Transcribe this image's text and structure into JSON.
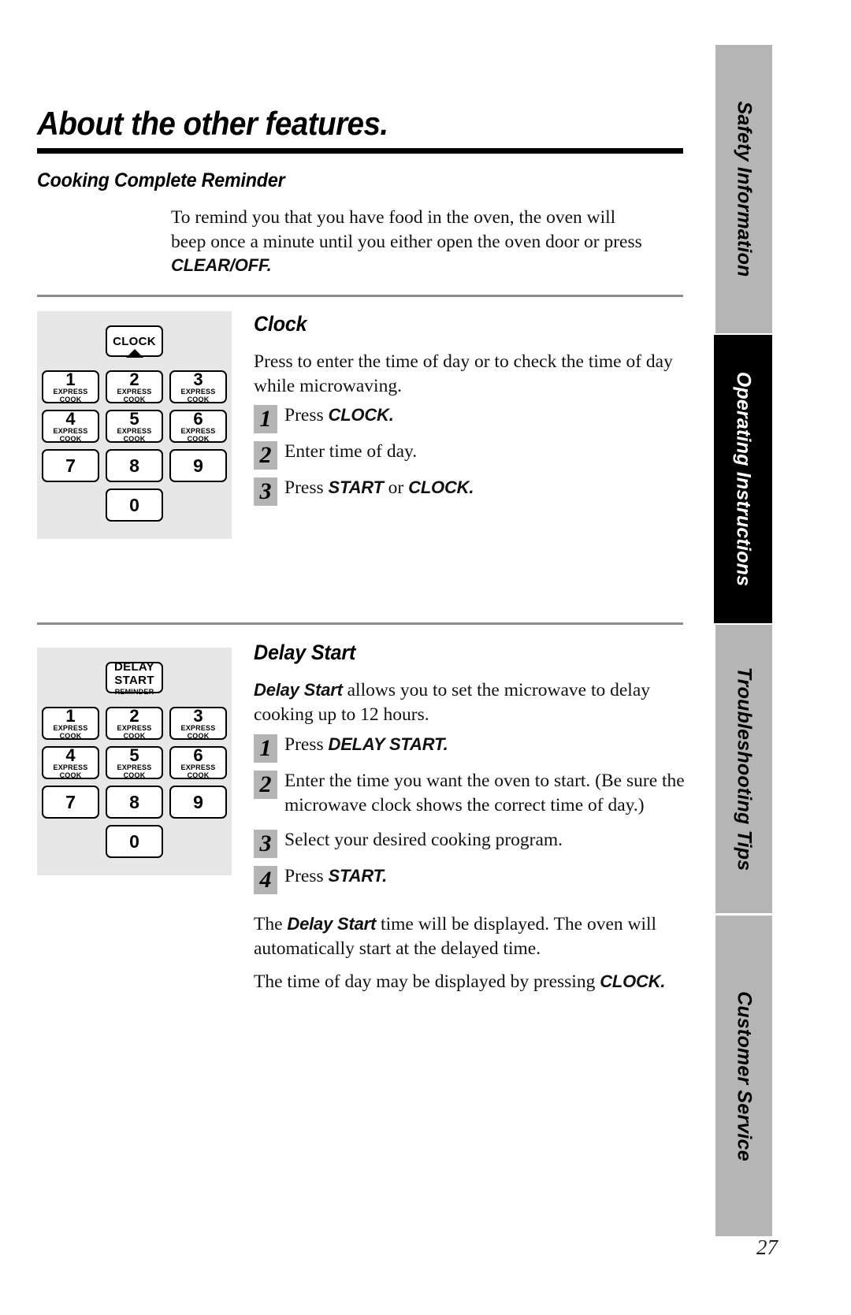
{
  "page": {
    "title": "About the other features.",
    "number": "27"
  },
  "sidebar": {
    "tabs": [
      {
        "label": "Safety Information",
        "active": false
      },
      {
        "label": "Operating Instructions",
        "active": true
      },
      {
        "label": "Troubleshooting Tips",
        "active": false
      },
      {
        "label": "Customer Service",
        "active": false
      }
    ]
  },
  "sections": {
    "reminder": {
      "heading": "Cooking Complete Reminder",
      "paragraph_pre": "To remind you that you have food in the oven, the oven will beep once a minute until you either open the oven door or press ",
      "paragraph_cmd": "CLEAR/OFF."
    },
    "clock": {
      "heading": "Clock",
      "intro": "Press to enter the time of day or to check the time of day while microwaving.",
      "steps": [
        {
          "num": "1",
          "pre": "Press ",
          "cmd": "CLOCK.",
          "post": ""
        },
        {
          "num": "2",
          "pre": "Enter time of day.",
          "cmd": "",
          "post": ""
        },
        {
          "num": "3",
          "pre": "Press ",
          "cmd": "START",
          "post": " or ",
          "cmd2": "CLOCK."
        }
      ],
      "keypad": {
        "function_key": {
          "label": "CLOCK",
          "sub": "",
          "pointer": true
        },
        "keys": [
          {
            "digit": "1",
            "sub": "EXPRESS COOK"
          },
          {
            "digit": "2",
            "sub": "EXPRESS COOK"
          },
          {
            "digit": "3",
            "sub": "EXPRESS COOK"
          },
          {
            "digit": "4",
            "sub": "EXPRESS COOK"
          },
          {
            "digit": "5",
            "sub": "EXPRESS COOK"
          },
          {
            "digit": "6",
            "sub": "EXPRESS COOK"
          },
          {
            "digit": "7",
            "sub": ""
          },
          {
            "digit": "8",
            "sub": ""
          },
          {
            "digit": "9",
            "sub": ""
          }
        ],
        "zero": {
          "digit": "0",
          "sub": ""
        }
      }
    },
    "delay_start": {
      "heading": "Delay Start",
      "intro_cmd": "Delay Start",
      "intro_rest": " allows you to set the microwave to delay cooking up to 12 hours.",
      "steps": [
        {
          "num": "1",
          "pre": "Press ",
          "cmd": "DELAY START.",
          "post": ""
        },
        {
          "num": "2",
          "pre": "Enter the time you want the oven to start. (Be sure the microwave clock shows the correct time of day.)",
          "cmd": "",
          "post": ""
        },
        {
          "num": "3",
          "pre": "Select your desired cooking program.",
          "cmd": "",
          "post": ""
        },
        {
          "num": "4",
          "pre": "Press ",
          "cmd": "START.",
          "post": ""
        }
      ],
      "outro1_pre": "The ",
      "outro1_cmd": "Delay Start",
      "outro1_post": " time will be displayed. The oven will automatically start at the delayed time.",
      "outro2_pre": "The time of day may be displayed by pressing ",
      "outro2_cmd": "CLOCK.",
      "keypad": {
        "function_key": {
          "label": "DELAY START",
          "sub": "REMINDER",
          "pointer": false
        },
        "keys": [
          {
            "digit": "1",
            "sub": "EXPRESS COOK"
          },
          {
            "digit": "2",
            "sub": "EXPRESS COOK"
          },
          {
            "digit": "3",
            "sub": "EXPRESS COOK"
          },
          {
            "digit": "4",
            "sub": "EXPRESS COOK"
          },
          {
            "digit": "5",
            "sub": "EXPRESS COOK"
          },
          {
            "digit": "6",
            "sub": "EXPRESS COOK"
          },
          {
            "digit": "7",
            "sub": ""
          },
          {
            "digit": "8",
            "sub": ""
          },
          {
            "digit": "9",
            "sub": ""
          }
        ],
        "zero": {
          "digit": "0",
          "sub": ""
        }
      }
    }
  }
}
